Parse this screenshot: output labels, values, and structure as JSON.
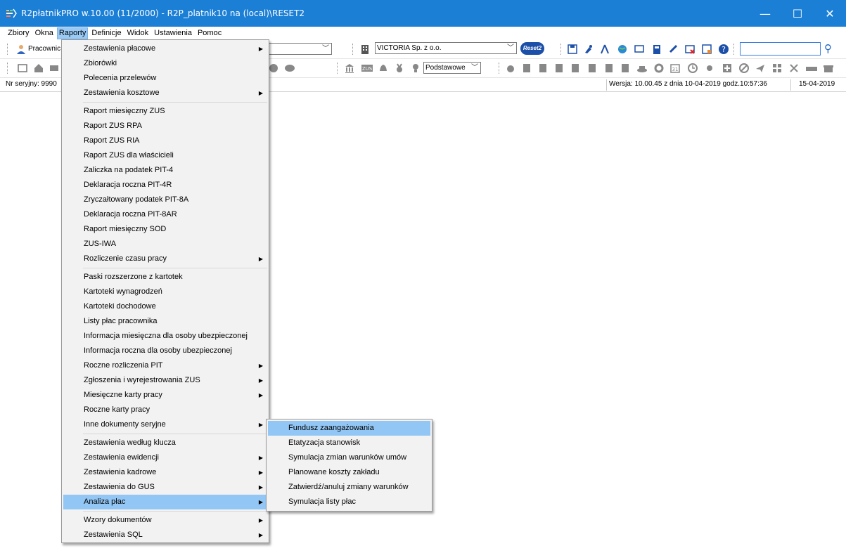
{
  "window": {
    "title": "R2płatnikPRO w.10.00 (11/2000) - R2P_platnik10 na (local)\\RESET2",
    "minimize": "—",
    "maximize": "☐",
    "close": "✕"
  },
  "menubar": [
    "Zbiory",
    "Okna",
    "Raporty",
    "Definicje",
    "Widok",
    "Ustawienia",
    "Pomoc"
  ],
  "toolbar": {
    "employee_label": "Pracownic",
    "company_combo": "VICTORIA Sp. z o.o.",
    "logo_text": "Reset2",
    "profile_combo": "Podstawowe",
    "search_placeholder": ""
  },
  "status": {
    "serial": "Nr seryjny: 9990",
    "version": "Wersja: 10.00.45 z dnia 10-04-2019 godz.10:57:36",
    "date": "15-04-2019"
  },
  "raporty_menu": [
    {
      "label": "Zestawienia płacowe",
      "sub": true
    },
    {
      "label": "Zbiorówki",
      "sub": false
    },
    {
      "label": "Polecenia przelewów",
      "sub": false
    },
    {
      "label": "Zestawienia kosztowe",
      "sub": true
    },
    {
      "sep": true
    },
    {
      "label": "Raport miesięczny ZUS",
      "sub": false
    },
    {
      "label": "Raport ZUS RPA",
      "sub": false
    },
    {
      "label": "Raport ZUS RIA",
      "sub": false
    },
    {
      "label": "Raport ZUS dla właścicieli",
      "sub": false
    },
    {
      "label": "Zaliczka na podatek PIT-4",
      "sub": false
    },
    {
      "label": "Deklaracja roczna PIT-4R",
      "sub": false
    },
    {
      "label": "Zryczałtowany podatek PIT-8A",
      "sub": false
    },
    {
      "label": "Deklaracja roczna PIT-8AR",
      "sub": false
    },
    {
      "label": "Raport miesięczny SOD",
      "sub": false
    },
    {
      "label": "ZUS-IWA",
      "sub": false
    },
    {
      "label": "Rozliczenie czasu pracy",
      "sub": true
    },
    {
      "sep": true
    },
    {
      "label": "Paski rozszerzone z kartotek",
      "sub": false
    },
    {
      "label": "Kartoteki wynagrodzeń",
      "sub": false
    },
    {
      "label": "Kartoteki dochodowe",
      "sub": false
    },
    {
      "label": "Listy płac pracownika",
      "sub": false
    },
    {
      "label": "Informacja miesięczna dla osoby ubezpieczonej",
      "sub": false
    },
    {
      "label": "Informacja roczna dla osoby ubezpieczonej",
      "sub": false
    },
    {
      "label": "Roczne rozliczenia PIT",
      "sub": true
    },
    {
      "label": "Zgłoszenia i wyrejestrowania ZUS",
      "sub": true
    },
    {
      "label": "Miesięczne karty pracy",
      "sub": true
    },
    {
      "label": "Roczne karty pracy",
      "sub": false
    },
    {
      "label": "Inne dokumenty seryjne",
      "sub": true
    },
    {
      "sep": true
    },
    {
      "label": "Zestawienia według klucza",
      "sub": false
    },
    {
      "label": "Zestawienia ewidencji",
      "sub": true
    },
    {
      "label": "Zestawienia kadrowe",
      "sub": true
    },
    {
      "label": "Zestawienia do GUS",
      "sub": true
    },
    {
      "label": "Analiza płac",
      "sub": true,
      "highlighted": true
    },
    {
      "sep": true
    },
    {
      "label": "Wzory dokumentów",
      "sub": true
    },
    {
      "label": "Zestawienia SQL",
      "sub": true
    }
  ],
  "analiza_submenu": [
    {
      "label": "Fundusz zaangażowania",
      "highlighted": true
    },
    {
      "label": "Etatyzacja stanowisk"
    },
    {
      "label": "Symulacja zmian warunków umów"
    },
    {
      "label": "Planowane koszty zakładu"
    },
    {
      "label": "Zatwierdź/anuluj zmiany warunków"
    },
    {
      "label": "Symulacja listy płac"
    }
  ],
  "colors": {
    "titlebar": "#1b7fd6",
    "highlight": "#92c6f4",
    "menu_bg": "#f2f2f2"
  }
}
